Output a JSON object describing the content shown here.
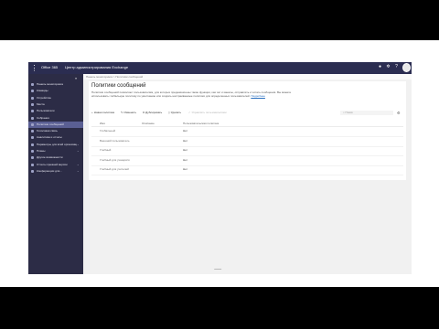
{
  "window": {
    "brand": "Office 365",
    "title": "Центр администрирования Exchange",
    "waffle_icon": "waffle-icon",
    "top_icons": [
      "bell-icon",
      "gear-icon",
      "help-icon"
    ]
  },
  "sidebar": {
    "collapse_glyph": "«",
    "items": [
      {
        "label": "Панель мониторинга",
        "icon": "dashboard-icon",
        "has_chevron": false
      },
      {
        "label": "Команды",
        "icon": "teams-icon",
        "has_chevron": false
      },
      {
        "label": "Устройства",
        "icon": "devices-icon",
        "has_chevron": false
      },
      {
        "label": "Места",
        "icon": "locations-icon",
        "has_chevron": false
      },
      {
        "label": "Пользователи",
        "icon": "users-icon",
        "has_chevron": false
      },
      {
        "label": "Собрания",
        "icon": "meetings-icon",
        "has_chevron": false
      },
      {
        "label": "Политики сообщений",
        "icon": "messaging-icon",
        "has_chevron": false,
        "active": true
      },
      {
        "label": "Голосовая связь",
        "icon": "voice-icon",
        "has_chevron": false
      },
      {
        "label": "Аналитика и отчеты",
        "icon": "analytics-icon",
        "has_chevron": false
      },
      {
        "label": "Параметры для всей организации",
        "icon": "org-settings-icon",
        "has_chevron": true
      },
      {
        "label": "Планы",
        "icon": "planning-icon",
        "has_chevron": true
      },
      {
        "label": "Другие возможности",
        "icon": "legacy-icon",
        "has_chevron": false
      },
      {
        "label": "Отчеты прежней версии",
        "icon": "reports-icon",
        "has_chevron": true
      },
      {
        "label": "Конференции для...",
        "icon": "call-quality-icon",
        "has_chevron": true
      }
    ]
  },
  "breadcrumb": "Панель мониторинга > Политики сообщений",
  "page": {
    "title": "Политики сообщений",
    "description": "Политики сообщений позволяют пользователям, для которых предназначены такие функции, как чат и каналы, отправлять и читать сообщения. Вы можете использовать глобальную политику по умолчанию или создать настраиваемые политики для определенных пользователей.",
    "link": "Подробнее"
  },
  "toolbar": {
    "new_label": "Новая политика",
    "edit_label": "Изменить",
    "copy_label": "Дублировать",
    "delete_label": "Удалить",
    "manage_label": "Управлять пользователями",
    "search_placeholder": "Поиск"
  },
  "table": {
    "columns": [
      "Имя",
      "Описание",
      "Пользовательская политика"
    ],
    "rows": [
      {
        "name": "Глобальный",
        "description": "",
        "custom": "Нет"
      },
      {
        "name": "Внешний пользователь",
        "description": "",
        "custom": "Нет"
      },
      {
        "name": "Учебный",
        "description": "",
        "custom": "Нет"
      },
      {
        "name": "Учебный для учащихся",
        "description": "",
        "custom": "Нет"
      },
      {
        "name": "Учебный для учителей",
        "description": "",
        "custom": "Нет"
      }
    ]
  }
}
